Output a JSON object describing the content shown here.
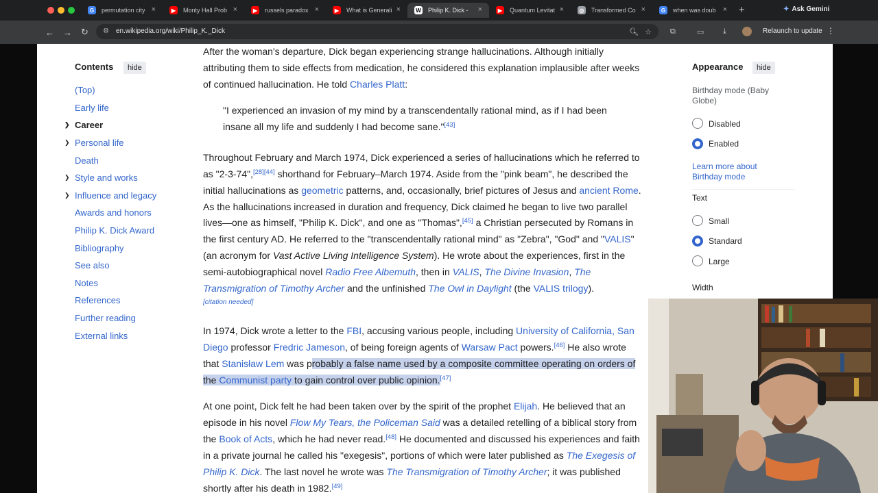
{
  "browser": {
    "tabs": [
      {
        "title": "permutation city",
        "icon": "google-icon",
        "icon_color": "#4285f4",
        "icon_char": "G"
      },
      {
        "title": "Monty Hall Prob",
        "icon": "youtube-icon",
        "icon_color": "#ff0000",
        "icon_char": "▶"
      },
      {
        "title": "russels paradox",
        "icon": "youtube-icon",
        "icon_color": "#ff0000",
        "icon_char": "▶"
      },
      {
        "title": "What is Generali",
        "icon": "youtube-icon",
        "icon_color": "#ff0000",
        "icon_char": "▶"
      },
      {
        "title": "Philip K. Dick -",
        "icon": "wikipedia-icon",
        "icon_color": "#ffffff",
        "icon_char": "W"
      },
      {
        "title": "Quantum Levitat",
        "icon": "youtube-icon",
        "icon_color": "#ff0000",
        "icon_char": "▶"
      },
      {
        "title": "Transformed Co",
        "icon": "globe-icon",
        "icon_color": "#9aa0a6",
        "icon_char": "◎"
      },
      {
        "title": "when was doub",
        "icon": "google-icon",
        "icon_color": "#4285f4",
        "icon_char": "G"
      }
    ],
    "ask_gemini": "Ask Gemini",
    "url": "en.wikipedia.org/wiki/Philip_K._Dick",
    "relaunch": "Relaunch to update"
  },
  "toc": {
    "title": "Contents",
    "hide": "hide",
    "items": [
      {
        "label": "(Top)"
      },
      {
        "label": "Early life"
      },
      {
        "label": "Career"
      },
      {
        "label": "Personal life"
      },
      {
        "label": "Death"
      },
      {
        "label": "Style and works"
      },
      {
        "label": "Influence and legacy"
      },
      {
        "label": "Awards and honors"
      },
      {
        "label": "Philip K. Dick Award"
      },
      {
        "label": "Bibliography"
      },
      {
        "label": "See also"
      },
      {
        "label": "Notes"
      },
      {
        "label": "References"
      },
      {
        "label": "Further reading"
      },
      {
        "label": "External links"
      }
    ]
  },
  "article": {
    "p1": [
      "After the woman's departure, Dick began experiencing strange hallucinations. Although initially",
      "attributing them to side effects from medication, he considered this explanation implausible after weeks",
      "of continued hallucination. He told"
    ],
    "p1_link": "Charles Platt",
    "p1_end": ":",
    "quote": [
      "\"I experienced an invasion of my mind by a transcendentally rational mind, as if I had been",
      "insane all my life and suddenly I had become sane.\""
    ],
    "quote_ref": "[43]",
    "p2": {
      "l1": "Throughout February and March 1974, Dick experienced a series of hallucinations which he referred to",
      "l2a": "as \"2-3-74\",",
      "ref28": "[28]",
      "ref44": "[44]",
      "l2b": " shorthand for February–March 1974. Aside from the \"pink beam\", he described the",
      "l3a": "initial hallucinations as ",
      "geometric": "geometric",
      "l3b": " patterns, and, occasionally, brief pictures of Jesus and ",
      "ancient_rome": "ancient Rome",
      "l3c": ".",
      "l4": "As the hallucinations increased in duration and frequency, Dick claimed he began to live two parallel",
      "l5a": "lives—one as himself, \"Philip K. Dick\", and one as \"Thomas\",",
      "ref45": "[45]",
      "l5b": " a Christian persecuted by Romans in",
      "l6a": "the first century AD. He referred to the \"transcendentally rational mind\" as \"Zebra\", \"God\" and \"",
      "valis": "VALIS",
      "l6b": "\"",
      "l7a": "(an acronym for ",
      "vals": "Vast Active Living Intelligence System",
      "l7b": "). He wrote about the experiences, first in the",
      "l8a": "semi-autobiographical novel ",
      "rfa": "Radio Free Albemuth",
      "l8b": ", then in ",
      "valis2": "VALIS",
      "l8c": ", ",
      "tdi": "The Divine Invasion",
      "l8d": ", ",
      "the": "The",
      "tta": "Transmigration of Timothy Archer",
      "l9b": " and the unfinished ",
      "owl": "The Owl in Daylight",
      "l9c": " (the ",
      "trilogy": "VALIS trilogy",
      "l9d": ").",
      "citation": "[citation needed]"
    },
    "p3": {
      "l1a": "In 1974, Dick wrote a letter to the ",
      "fbi": "FBI",
      "l1b": ", accusing various people, including ",
      "ucsd": "University of California, San",
      "ucsd2": "Diego",
      "l2b": " professor ",
      "jameson": "Fredric Jameson",
      "l2c": ", of being foreign agents of ",
      "warsaw": "Warsaw Pact",
      "l2d": " powers.",
      "ref46": "[46]",
      "l2e": " He also wrote",
      "l3a": "that ",
      "lem": "Stanisław Lem",
      "l3b": " was p",
      "l3hl": "robably a false name used by a composite committee operating on orders of",
      "l4a": "the ",
      "communist": "Communist party",
      "l4b": " to gain control over public opinion.",
      "ref47": "[47]"
    },
    "p4": {
      "l1a": "At one point, Dick felt he had been taken over by the spirit of the prophet ",
      "elijah": "Elijah",
      "l1b": ". He believed that an",
      "l2a": "episode in his novel ",
      "fmt": "Flow My Tears, the Policeman Said",
      "l2b": " was a detailed retelling of a biblical story from",
      "l3a": "the ",
      "acts": "Book of Acts",
      "l3b": ", which he had never read.",
      "ref48": "[48]",
      "l3c": " He documented and discussed his experiences and faith",
      "l4a": "in a private journal he called his \"exegesis\", portions of which were later published as ",
      "exeg": "The Exegesis of",
      "exeg2": "Philip K. Dick",
      "l5b": ". The last novel he wrote was ",
      "tta2": "The Transmigration of Timothy Archer",
      "l5c": "; it was published",
      "l6": "shortly after his death in 1982.",
      "ref49": "[49]"
    }
  },
  "appearance": {
    "title": "Appearance",
    "hide": "hide",
    "birthday_label": "Birthday mode (Baby Globe)",
    "disabled": "Disabled",
    "enabled": "Enabled",
    "learn_more": "Learn more about Birthday mode",
    "text_label": "Text",
    "small": "Small",
    "standard": "Standard",
    "large": "Large",
    "width_label": "Width"
  },
  "colors": {
    "link": "#3366cc",
    "highlight": "#c6d2ec",
    "chrome_dark": "#1f2021",
    "chrome_toolbar": "#3a3b3d"
  }
}
